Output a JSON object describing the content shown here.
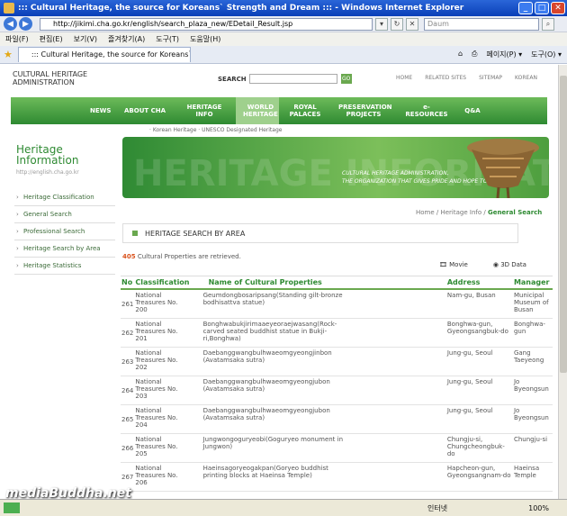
{
  "window": {
    "title": "::: Cultural Heritage, the source for Koreans` Strength and Dream ::: - Windows Internet Explorer"
  },
  "browser": {
    "url": "http://jikimi.cha.go.kr/english/search_plaza_new/EDetail_Result.jsp",
    "search_placeholder": "Daum",
    "menu": [
      "파일(F)",
      "편집(E)",
      "보기(V)",
      "즐겨찾기(A)",
      "도구(T)",
      "도움말(H)"
    ],
    "tab_title": "::: Cultural Heritage, the source for Koreans` ...",
    "tools": [
      "페이지(P) ▾",
      "도구(O) ▾"
    ],
    "status_zone": "인터넷",
    "zoom": "100%"
  },
  "site": {
    "logo_line1": "CULTURAL HERITAGE",
    "logo_line2": "ADMINISTRATION",
    "search_label": "SEARCH",
    "search_go": "GO",
    "top_links": [
      "HOME",
      "RELATED SITES",
      "SITEMAP",
      "KOREAN"
    ],
    "gnb": [
      "NEWS",
      "ABOUT CHA",
      "HERITAGE INFO",
      "WORLD HERITAGE",
      "ROYAL PALACES",
      "PRESERVATION PROJECTS",
      "e-RESOURCES",
      "Q&A"
    ],
    "subnav": "· Korean Heritage · UNESCO Designated Heritage"
  },
  "sidebar": {
    "title_line1": "Heritage",
    "title_line2": "Information",
    "url": "http://english.cha.go.kr",
    "items": [
      {
        "label": "Heritage Classification"
      },
      {
        "label": "General Search"
      },
      {
        "label": "Professional Search"
      },
      {
        "label": "Heritage Search by Area"
      },
      {
        "label": "Heritage Statistics"
      }
    ]
  },
  "banner": {
    "big_text": "HERITAGE INFORMATION",
    "line1": "CULTURAL HERITAGE ADMINISTRATION,",
    "line2": "THE ORGANIZATION THAT GIVES PRIDE AND HOPE TO KOREANS"
  },
  "breadcrumb": {
    "home": "Home",
    "level1": "Heritage Info",
    "current": "General Search"
  },
  "section_title": "HERITAGE SEARCH BY AREA",
  "result": {
    "count": "405",
    "text": " Cultural Properties are retrieved."
  },
  "media": {
    "movie": "Movie",
    "3d": "3D Data"
  },
  "table": {
    "headers": [
      "No",
      "Classification",
      "Name of Cultural Properties",
      "Address",
      "Manager"
    ],
    "rows": [
      {
        "no": "261",
        "classification": "National Treasures No. 200",
        "name": "Geumdongbosaripsang(Standing gilt-bronze bodhisattva statue)",
        "address": "Nam-gu, Busan",
        "manager": "Municipal Museum of Busan"
      },
      {
        "no": "262",
        "classification": "National Treasures No. 201",
        "name": "Bonghwabukjirimaaeyeoraejwasang(Rock-carved seated buddhist statue in Bukji-ri,Bonghwa)",
        "address": "Bonghwa-gun, Gyeongsangbuk-do",
        "manager": "Bonghwa-gun"
      },
      {
        "no": "263",
        "classification": "National Treasures No. 202",
        "name": "Daebanggwangbulhwaeomgyeongjinbon (Avatamsaka sutra)",
        "address": "Jung-gu, Seoul",
        "manager": "Gang Taeyeong"
      },
      {
        "no": "264",
        "classification": "National Treasures No. 203",
        "name": "Daebanggwangbulhwaeomgyeongjubon (Avatamsaka sutra)",
        "address": "Jung-gu, Seoul",
        "manager": "Jo Byeongsun"
      },
      {
        "no": "265",
        "classification": "National Treasures No. 204",
        "name": "Daebanggwangbulhwaeomgyeongjubon (Avatamsaka sutra)",
        "address": "Jung-gu, Seoul",
        "manager": "Jo Byeongsun"
      },
      {
        "no": "266",
        "classification": "National Treasures No. 205",
        "name": "Jungwongoguryeobi(Goguryeo monument in Jungwon)",
        "address": "Chungju-si, Chungcheongbuk-do",
        "manager": "Chungju-si"
      },
      {
        "no": "267",
        "classification": "National Treasures No. 206",
        "name": "Haeinsagoryeogakpan(Goryeo buddhist printing blocks at Haeinsa Temple)",
        "address": "Hapcheon-gun, Gyeongsangnam-do",
        "manager": "Haeinsa Temple"
      }
    ]
  },
  "watermark": "mediaBuddha.net"
}
